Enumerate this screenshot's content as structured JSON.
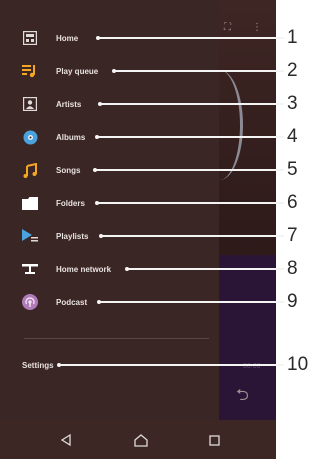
{
  "drawer": {
    "items": [
      {
        "label": "Home",
        "icon": "home-icon"
      },
      {
        "label": "Play queue",
        "icon": "play-queue-icon"
      },
      {
        "label": "Artists",
        "icon": "artists-icon"
      },
      {
        "label": "Albums",
        "icon": "albums-icon"
      },
      {
        "label": "Songs",
        "icon": "songs-icon"
      },
      {
        "label": "Folders",
        "icon": "folders-icon"
      },
      {
        "label": "Playlists",
        "icon": "playlists-icon"
      },
      {
        "label": "Home network",
        "icon": "home-network-icon"
      },
      {
        "label": "Podcast",
        "icon": "podcast-icon"
      }
    ],
    "settings_label": "Settings"
  },
  "callouts": [
    "1",
    "2",
    "3",
    "4",
    "5",
    "6",
    "7",
    "8",
    "9",
    "10"
  ],
  "navbar": {
    "back_icon": "back-icon",
    "home_icon": "home-nav-icon",
    "recents_icon": "recents-icon"
  },
  "colors": {
    "drawer_bg": "#3a2624",
    "accent_orange": "#f5a623",
    "albums_blue": "#4aa3df",
    "podcast_purple": "#b07ab8",
    "label_text": "#e8e2e1",
    "callout_text": "#2a2a2a"
  }
}
